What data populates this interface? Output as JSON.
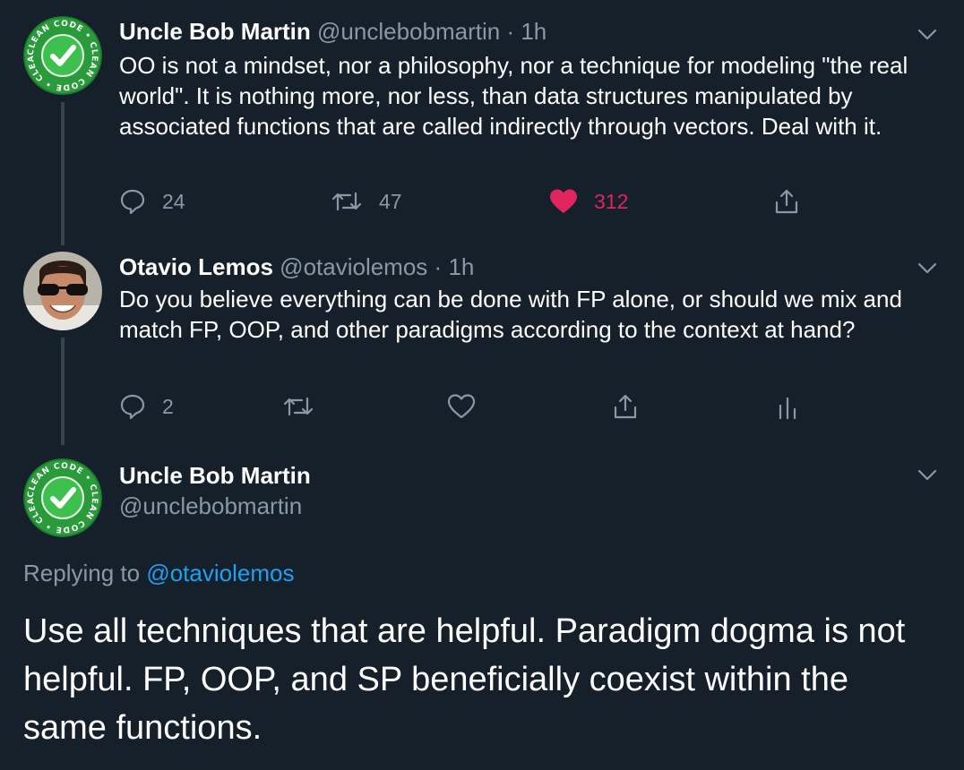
{
  "tweets": [
    {
      "name": "Uncle Bob Martin",
      "handle": "@unclebobmartin",
      "dot": "·",
      "time": "1h",
      "text": "OO is not a mindset, nor a philosophy, nor a technique for modeling \"the real world\".  It is nothing more, nor less, than data structures manipulated by associated functions that are called indirectly through vectors.  Deal with it.",
      "replies": "24",
      "retweets": "47",
      "likes": "312",
      "avatar": "clean-code-badge"
    },
    {
      "name": "Otavio Lemos",
      "handle": "@otaviolemos",
      "dot": "·",
      "time": "1h",
      "text": "Do you believe everything can be done with FP alone, or should we mix and match FP, OOP, and other paradigms according to the context at hand?",
      "replies": "2",
      "avatar": "profile-photo"
    },
    {
      "name": "Uncle Bob Martin",
      "handle": "@unclebobmartin",
      "replying_label": "Replying to",
      "replying_to": "@otaviolemos",
      "text": "Use all techniques that are helpful. Paradigm dogma is not helpful. FP, OOP, and SP beneficially coexist within the same functions.",
      "avatar": "clean-code-badge"
    }
  ],
  "colors": {
    "background": "#15202b",
    "text": "#ffffff",
    "secondary": "#8899a6",
    "link": "#1da1f2",
    "like": "#e0245e",
    "thread_line": "#38444d",
    "badge_green": "#27ae3e"
  },
  "badge_text": "CLEAN CODE • CLEAN CODE • CLEAN CODE •"
}
